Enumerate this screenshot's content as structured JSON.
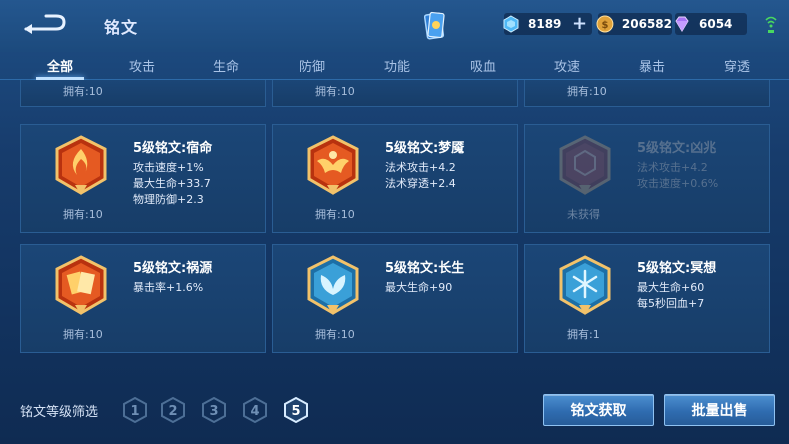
{
  "header": {
    "title": "铭文",
    "currencies": [
      {
        "name": "gem-icon",
        "value": "8189",
        "color": "#5fc3ff"
      },
      {
        "name": "gold-coin-icon",
        "value": "206582",
        "color": "#e7a33a"
      },
      {
        "name": "diamond-icon",
        "value": "6054",
        "color": "#b17cff"
      }
    ],
    "plus": "+"
  },
  "tabs": [
    {
      "label": "全部",
      "active": true
    },
    {
      "label": "攻击"
    },
    {
      "label": "生命"
    },
    {
      "label": "防御"
    },
    {
      "label": "功能"
    },
    {
      "label": "吸血"
    },
    {
      "label": "攻速"
    },
    {
      "label": "暴击"
    },
    {
      "label": "穿透"
    }
  ],
  "partial_row": [
    "拥有:10",
    "拥有:10",
    "拥有:10"
  ],
  "runes": [
    {
      "name": "5级铭文:宿命",
      "stats": [
        "攻击速度+1%",
        "最大生命+33.7",
        "物理防御+2.3"
      ],
      "owned": "拥有:10",
      "icon": "crimson-flame-emblem-icon",
      "color": "#d94a22"
    },
    {
      "name": "5级铭文:梦魇",
      "stats": [
        "法术攻击+4.2",
        "法术穿透+2.4"
      ],
      "owned": "拥有:10",
      "icon": "crimson-bat-emblem-icon",
      "color": "#d94a22"
    },
    {
      "name": "5级铭文:凶兆",
      "stats": [
        "法术攻击+4.2",
        "攻击速度+0.6%"
      ],
      "owned": "未获得",
      "icon": "crimson-hex-emblem-icon",
      "color": "#a84a4a",
      "locked": true
    },
    {
      "name": "5级铭文:祸源",
      "stats": [
        "暴击率+1.6%"
      ],
      "owned": "拥有:10",
      "icon": "crimson-cards-emblem-icon",
      "color": "#d94a22"
    },
    {
      "name": "5级铭文:长生",
      "stats": [
        "最大生命+90"
      ],
      "owned": "拥有:10",
      "icon": "azure-leaf-emblem-icon",
      "color": "#3aa0d8"
    },
    {
      "name": "5级铭文:冥想",
      "stats": [
        "最大生命+60",
        "每5秒回血+7"
      ],
      "owned": "拥有:1",
      "icon": "azure-snowflake-emblem-icon",
      "color": "#3aa0d8"
    }
  ],
  "footer": {
    "filter_label": "铭文等级筛选",
    "levels": [
      "1",
      "2",
      "3",
      "4",
      "5"
    ],
    "selected_level": "5",
    "acquire_label": "铭文获取",
    "sell_label": "批量出售"
  }
}
